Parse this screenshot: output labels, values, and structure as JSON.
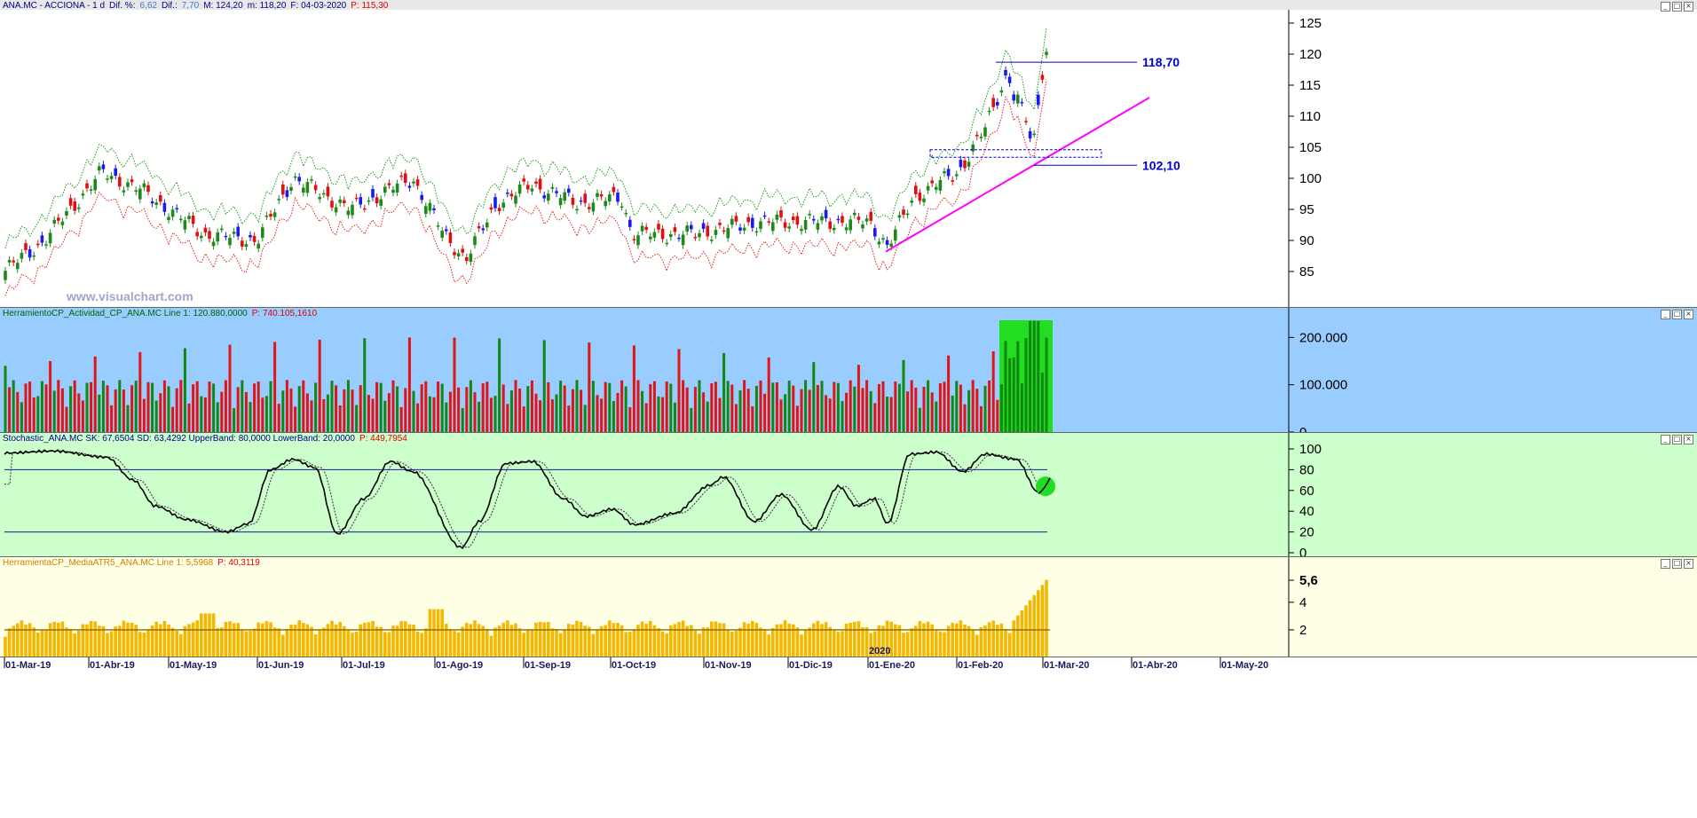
{
  "price_pane": {
    "title_segments": [
      {
        "text": "ANA.MC - ACCIONA - 1 d",
        "color": "#00008b"
      },
      {
        "text": "Dif. %:",
        "color": "#00008b"
      },
      {
        "text": "6,62",
        "color": "#3a7bd5"
      },
      {
        "text": "Dif.:",
        "color": "#00008b"
      },
      {
        "text": "7,70",
        "color": "#3a7bd5"
      },
      {
        "text": "M: 124,20",
        "color": "#00008b"
      },
      {
        "text": "m: 118,20",
        "color": "#00008b"
      },
      {
        "text": "F: 04-03-2020",
        "color": "#00008b"
      },
      {
        "text": "P: 115,30",
        "color": "#e00000"
      }
    ],
    "watermark": "www.visualchart.com",
    "level_high_label": "118,70",
    "level_low_label": "102,10",
    "axis_ticks": [
      "125",
      "120",
      "115",
      "110",
      "105",
      "100",
      "95",
      "90",
      "85"
    ]
  },
  "volume_pane": {
    "title_segments": [
      {
        "text": "HerramientoCP_Actividad_CP_ANA.MC  Line 1: 120.880,0000",
        "color": "#006400"
      },
      {
        "text": "P: 740.105,1610",
        "color": "#e00000"
      }
    ],
    "axis_ticks": [
      "200.000",
      "100.000",
      "0"
    ]
  },
  "stoch_pane": {
    "title_segments": [
      {
        "text": "Stochastic_ANA.MC  SK: 67,6504  SD: 63,4292  UpperBand: 80,0000  LowerBand: 20,0000",
        "color": "#00008b"
      },
      {
        "text": "P: 449,7954",
        "color": "#e00000"
      }
    ],
    "axis_ticks": [
      "100",
      "80",
      "60",
      "40",
      "20",
      "0"
    ]
  },
  "atr_pane": {
    "title_segments": [
      {
        "text": "HerramientaCP_MediaATR5_ANA.MC  Line 1: 5,5968",
        "color": "#d08000"
      },
      {
        "text": "P: 40,3119",
        "color": "#e00000"
      }
    ],
    "axis_ticks": [
      "5,6",
      "4",
      "2"
    ]
  },
  "date_axis": {
    "labels": [
      "01-Mar-19",
      "01-Abr-19",
      "01-May-19",
      "01-Jun-19",
      "01-Jul-19",
      "01-Ago-19",
      "01-Sep-19",
      "01-Oct-19",
      "01-Nov-19",
      "01-Dic-19",
      "01-Ene-20",
      "01-Feb-20",
      "01-Mar-20",
      "01-Abr-20",
      "01-May-20"
    ],
    "year_marker": "2020"
  },
  "chart_data": {
    "type": "candlestick",
    "symbol": "ANA.MC - ACCIONA",
    "ylim": [
      81,
      127
    ],
    "levels": [
      118.7,
      102.1
    ],
    "monthly_closes": {
      "dates": [
        "01-Mar-19",
        "01-Abr-19",
        "01-May-19",
        "01-Jun-19",
        "01-Jul-19",
        "01-Ago-19",
        "01-Sep-19",
        "01-Oct-19",
        "01-Nov-19",
        "01-Dic-19",
        "01-Ene-20",
        "01-Feb-20",
        "04-03-2020"
      ],
      "values": [
        86,
        101,
        93,
        99,
        96,
        90,
        98,
        92,
        93,
        93,
        96,
        115,
        115.3
      ]
    },
    "last_bar": {
      "high": 124.2,
      "low": 118.2,
      "close": 115.3,
      "diff": 7.7,
      "diff_pct": 6.62
    },
    "volume": {
      "last": 120880,
      "ylim": [
        0,
        240000
      ]
    },
    "stochastic": {
      "sk": 67.6504,
      "sd": 63.4292,
      "upper_band": 80,
      "lower_band": 20,
      "ylim": [
        0,
        100
      ]
    },
    "atr5": {
      "last": 5.5968,
      "ylim": [
        0,
        6.5
      ]
    }
  }
}
